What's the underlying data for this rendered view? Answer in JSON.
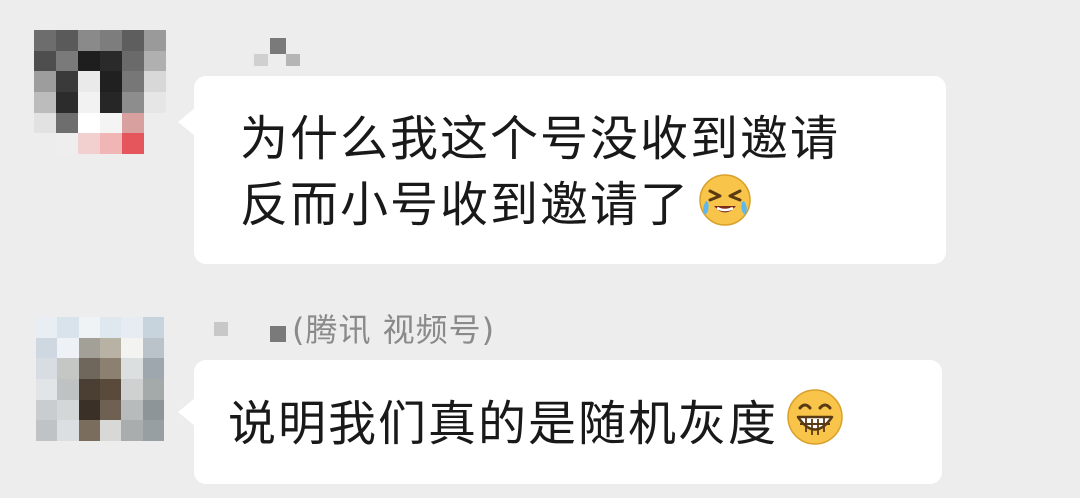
{
  "messages": [
    {
      "lines": [
        "为什么我这个号没收到邀请",
        "反而小号收到邀请了"
      ],
      "emoji": "crying-laugh-emoji"
    },
    {
      "sender_tag": "(腾讯 视频号)",
      "lines": [
        "说明我们真的是随机灰度"
      ],
      "emoji": "grin-emoji"
    }
  ],
  "colors": {
    "background": "#ededed",
    "bubble": "#ffffff",
    "text": "#191919",
    "secondary_text": "#8a8a8a",
    "emoji_face": "#f8c44a"
  }
}
